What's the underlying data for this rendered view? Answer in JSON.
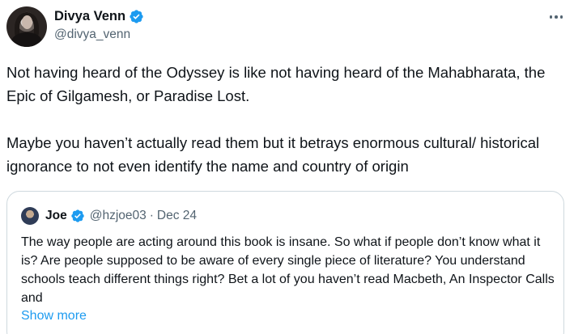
{
  "author": {
    "display_name": "Divya Venn",
    "handle": "@divya_venn",
    "verified": true,
    "avatar": "user-avatar-photo"
  },
  "menu": {
    "icon": "more-horizontal-icon"
  },
  "tweet": {
    "paragraphs": [
      "Not having heard of the Odyssey is like not having heard of the Mahabharata, the Epic of Gilgamesh, or Paradise Lost.",
      "Maybe you haven’t actually read them but it betrays enormous cultural/ historical ignorance to not even identify the name and country of origin"
    ]
  },
  "quote": {
    "display_name": "Joe",
    "handle": "@hzjoe03",
    "separator": "·",
    "date": "Dec 24",
    "verified": true,
    "text": "The way people are acting around this book is insane. So what if people don’t know what it is? Are people supposed to be aware of every single piece of literature? You understand schools teach different things right? Bet a lot of you haven’t read Macbeth, An Inspector Calls and",
    "show_more": "Show more"
  },
  "colors": {
    "text": "#0f1419",
    "secondary": "#536471",
    "accent": "#1d9bf0",
    "border": "#cfd9de"
  }
}
